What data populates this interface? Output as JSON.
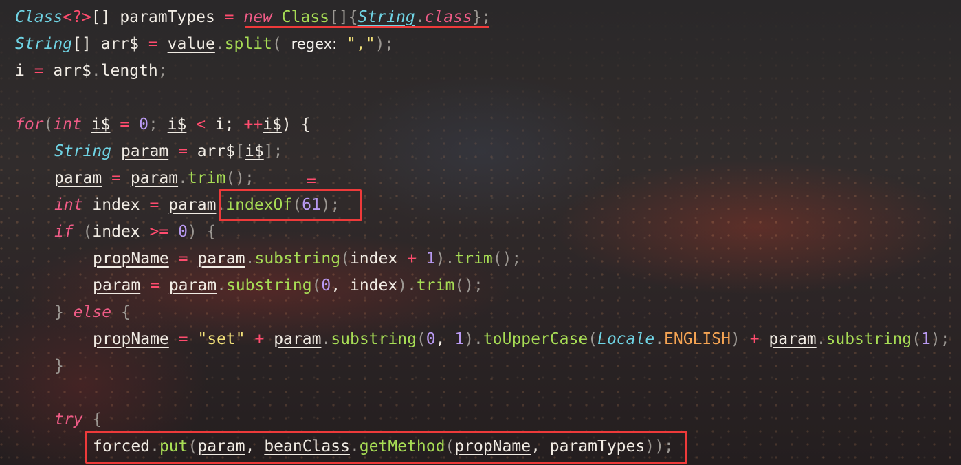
{
  "l1": {
    "a": "Class",
    "b": "<?>",
    "c": "[] paramTypes ",
    "d": "=",
    "e": " ",
    "f": "new",
    "g": " ",
    "h": "Class",
    "i": "[]",
    "j": "{",
    "k": "String",
    "l": ".",
    "m": "class",
    "n": "}",
    "o": ";"
  },
  "l2": {
    "a": "String",
    "b": "[] arr$ ",
    "c": "=",
    "d": " ",
    "e": "value",
    "f": ".",
    "g": "split",
    "h": "(",
    "i": " ",
    "hint": "regex:",
    "j": " ",
    "k": "\",\"",
    "l": ")",
    "m": ";"
  },
  "l3": {
    "a": "i ",
    "b": "=",
    "c": " arr$",
    "d": ".",
    "e": "length",
    "f": ";"
  },
  "l5": {
    "a": "for",
    "b": "(",
    "c": "int",
    "d": " ",
    "e": "i$",
    "f": " ",
    "g": "=",
    "h": " ",
    "i": "0",
    "j": "; ",
    "k": "i$",
    "l": " ",
    "m": "<",
    "n": " i; ",
    "o": "++",
    "p": "i$",
    "q": ") {"
  },
  "l6": {
    "a": "String",
    "b": " ",
    "c": "param",
    "d": " ",
    "e": "=",
    "f": " arr$",
    "g": "[",
    "h": "i$",
    "i": "];"
  },
  "l7": {
    "a": "param",
    "b": " ",
    "c": "=",
    "d": " ",
    "e": "param",
    "f": ".",
    "g": "trim",
    "h": "();"
  },
  "l7marker": "=",
  "l8": {
    "a": "int",
    "b": " index ",
    "c": "=",
    "d": " ",
    "e": "param",
    "f": ".",
    "g": "indexOf",
    "h": "(",
    "i": "61",
    "j": ");"
  },
  "l9": {
    "a": "if",
    "b": " (",
    "c": "index ",
    "d": ">=",
    "e": " ",
    "f": "0",
    "g": ") {"
  },
  "l10": {
    "a": "propName",
    "b": " ",
    "c": "=",
    "d": " ",
    "e": "param",
    "f": ".",
    "g": "substring",
    "h": "(",
    "i": "index ",
    "j": "+",
    "k": " ",
    "l": "1",
    "m": ").",
    "n": "trim",
    "o": "();"
  },
  "l11": {
    "a": "param",
    "b": " ",
    "c": "=",
    "d": " ",
    "e": "param",
    "f": ".",
    "g": "substring",
    "h": "(",
    "i": "0",
    "j": ", index",
    "k": ").",
    "l": "trim",
    "m": "();"
  },
  "l12": {
    "a": "} ",
    "b": "else",
    "c": " {"
  },
  "l13": {
    "a": "propName",
    "b": " ",
    "c": "=",
    "d": " ",
    "e": "\"set\"",
    "f": " ",
    "g": "+",
    "h": " ",
    "i": "param",
    "j": ".",
    "k": "substring",
    "l": "(",
    "m": "0",
    "n": ", ",
    "o": "1",
    "p": ").",
    "q": "toUpperCase",
    "r": "(",
    "s": "Locale",
    "t": ".",
    "u": "ENGLISH",
    "v": ") ",
    "w": "+",
    "x": " ",
    "y": "param",
    "z": ".",
    "aa": "substring",
    "ab": "(",
    "ac": "1",
    "ad": ");"
  },
  "l14": {
    "a": "}"
  },
  "l16": {
    "a": "try",
    "b": " {"
  },
  "l17": {
    "a": "forced",
    "b": ".",
    "c": "put",
    "d": "(",
    "e": "param",
    "f": ", ",
    "g": "beanClass",
    "h": ".",
    "i": "getMethod",
    "j": "(",
    "k": "propName",
    "l": ", paramTypes",
    "m": "));"
  },
  "colors": {
    "background": "#2d2727",
    "text": "#f1ece4",
    "keyword": "#ef5b86",
    "type": "#6fd3e3",
    "number": "#b99af2",
    "operator": "#ff4c6e",
    "function": "#a7dd55",
    "string": "#f3e27a",
    "constant": "#f5a453",
    "highlight_box": "#ee3a3a"
  }
}
